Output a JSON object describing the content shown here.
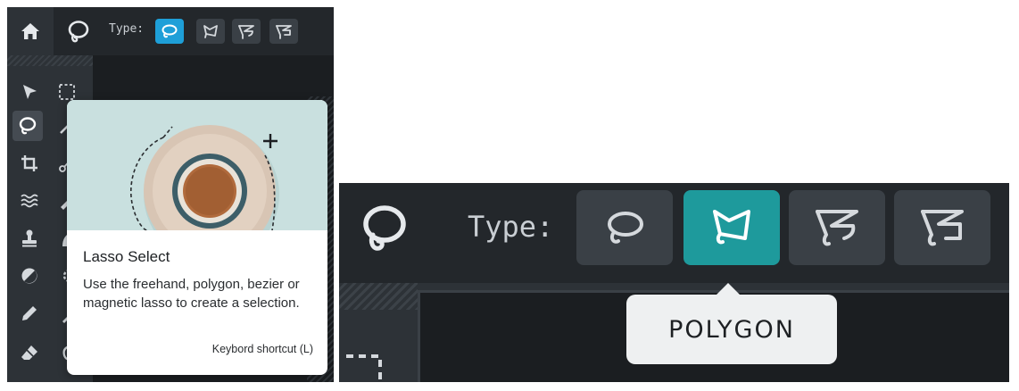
{
  "toolbar": {
    "type_label": "Type:",
    "lasso_types": [
      {
        "name": "freehand",
        "icon": "freehand-lasso-icon"
      },
      {
        "name": "polygon",
        "icon": "polygon-lasso-icon"
      },
      {
        "name": "bezier",
        "icon": "bezier-lasso-icon"
      },
      {
        "name": "magnetic",
        "icon": "magnetic-lasso-icon"
      }
    ],
    "selected_left": "freehand",
    "selected_right": "polygon"
  },
  "sidebar": {
    "tools": [
      "arrow-select",
      "marquee-select",
      "lasso-select",
      "magic-wand",
      "crop",
      "cut",
      "liquify",
      "brush",
      "stamp",
      "smudge",
      "dodge-burn",
      "color-picker",
      "pencil",
      "eyedropper",
      "eraser",
      "patch"
    ],
    "active_tool": "lasso-select"
  },
  "tooltip_card": {
    "title": "Lasso Select",
    "description": "Use the freehand, polygon, bezier or magnetic lasso to create a selection.",
    "shortcut": "Keybord shortcut (L)"
  },
  "hover_tooltip": {
    "label": "POLYGON"
  },
  "colors": {
    "panel_bg": "#2d3237",
    "topbar_bg": "#23272b",
    "canvas_bg": "#1b1e21",
    "active_blue": "#1e9fd8",
    "active_teal": "#1e9a9c",
    "icon": "#d5d9dd"
  }
}
